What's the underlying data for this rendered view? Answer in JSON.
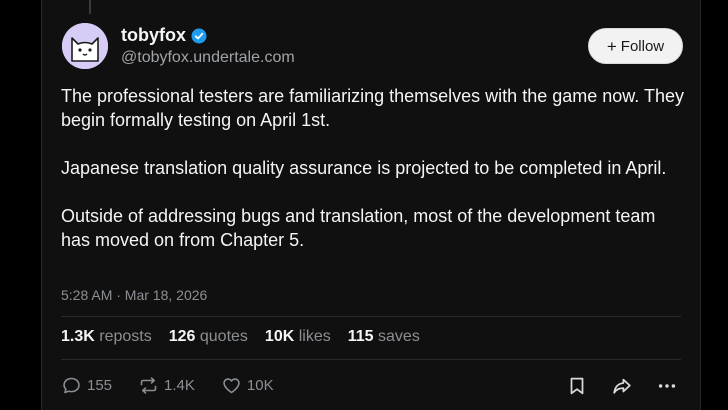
{
  "author": {
    "name": "tobyfox",
    "handle": "@tobyfox.undertale.com",
    "verified": true
  },
  "follow_button": {
    "plus": "+",
    "label": "Follow"
  },
  "post": {
    "paragraphs": [
      "The professional testers are familiarizing themselves with the game now. They begin formally testing on April 1st.",
      "Japanese translation quality assurance is projected to be completed in April.",
      "Outside of addressing bugs and translation, most of the development team has moved on from Chapter 5."
    ],
    "timestamp": "5:28 AM · Mar 18, 2026"
  },
  "stats": [
    {
      "value": "1.3K",
      "label": "reposts"
    },
    {
      "value": "126",
      "label": "quotes"
    },
    {
      "value": "10K",
      "label": "likes"
    },
    {
      "value": "115",
      "label": "saves"
    }
  ],
  "actions": {
    "replies": "155",
    "reposts": "1.4K",
    "likes": "10K"
  },
  "icons": {
    "reply": "reply-icon",
    "repost": "repost-icon",
    "like": "heart-icon",
    "bookmark": "bookmark-icon",
    "share": "share-icon",
    "more": "more-icon",
    "verified": "verified-badge-icon"
  },
  "colors": {
    "page_background": "#000000",
    "card_background": "#101010",
    "text_primary": "#f3f5f7",
    "text_secondary": "#8b8f93",
    "verified_blue": "#1d9bf0",
    "avatar_background": "#d7ccf5"
  }
}
